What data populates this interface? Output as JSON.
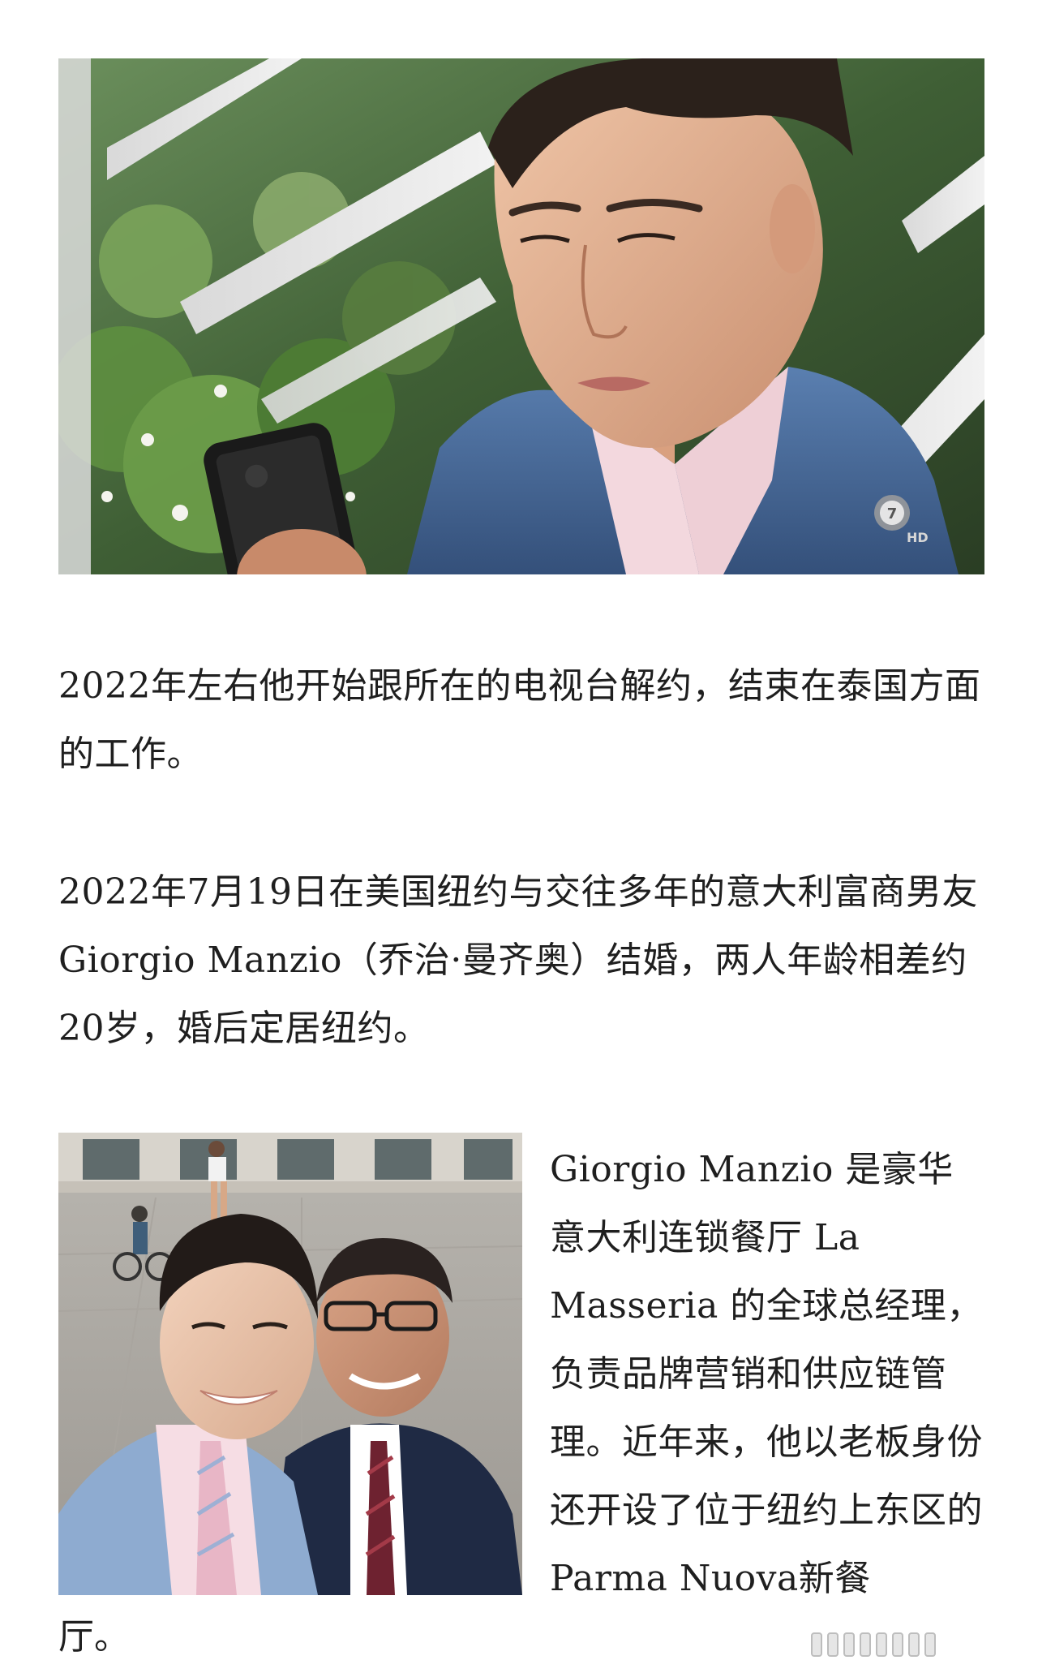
{
  "hero": {
    "badge_text": "HD",
    "badge_number": "7"
  },
  "para1": "2022年左右他开始跟所在的电视台解约，结束在泰国方面的工作。",
  "para2": "2022年7月19日在美国纽约与交往多年的意大利富商男友Giorgio Manzio（乔治·曼齐奥）结婚，两人年龄相差约20岁，婚后定居纽约。",
  "para3_side": "Giorgio Manzio 是豪华意大利连锁餐厅 La Masseria 的全球总经理，负责品牌营销和供应链管理。近年来，他以老板身份还开设了位于纽约上东区的 Parma Nuova新餐",
  "para3_tail": "厅。",
  "colors": {
    "text": "#1f1f1f",
    "suit_blue": "#4a6f9c",
    "foliage": "#4f7a3a"
  }
}
